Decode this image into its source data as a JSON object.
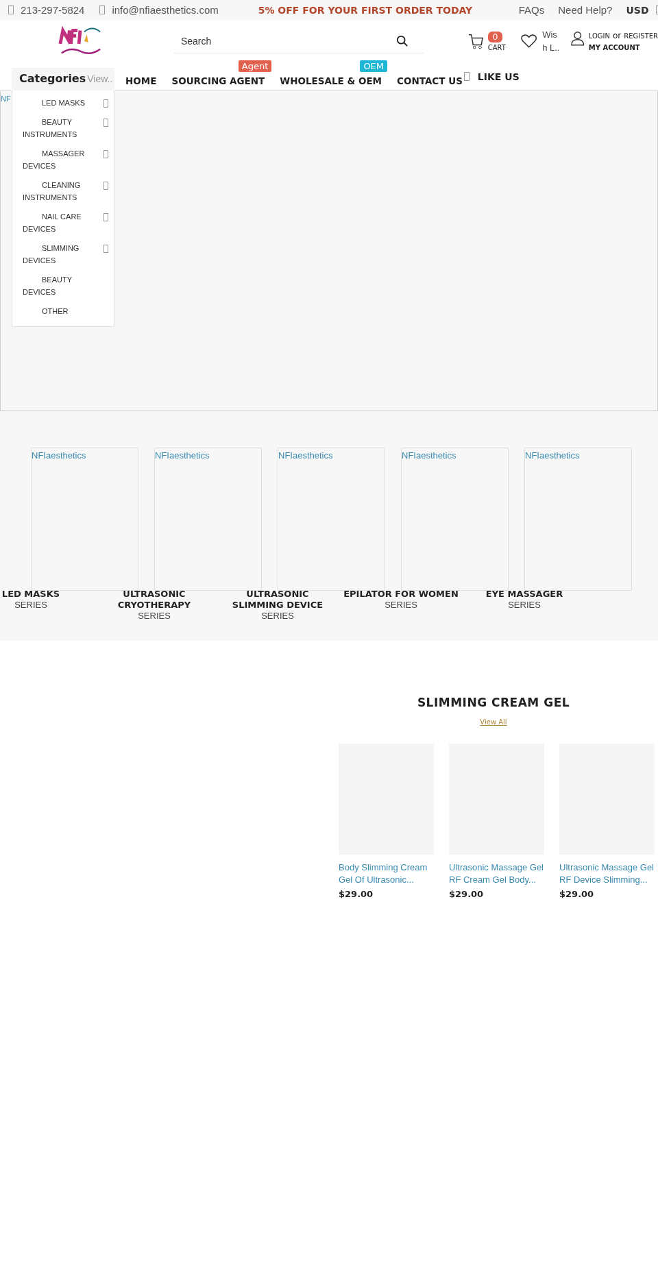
{
  "top_bar": {
    "phone": "213-297-5824",
    "email": "info@nfiaesthetics.com",
    "promo": "5% OFF FOR YOUR FIRST ORDER TODAY",
    "links": [
      "FAQs",
      "Need Help?"
    ],
    "currency": "USD"
  },
  "header": {
    "search": {
      "placeholder": "Search"
    },
    "cart": {
      "count": "0",
      "label": "CART"
    },
    "wishlist": {
      "label": "Wish L.."
    },
    "account": {
      "login": "LOGIN",
      "or": "or",
      "register": "REGISTER",
      "label": "MY ACCOUNT"
    }
  },
  "categories": {
    "title": "Categories",
    "view": "View..",
    "items": [
      {
        "label": "LED MASKS",
        "has_submenu": true
      },
      {
        "label": "BEAUTY INSTRUMENTS",
        "has_submenu": true
      },
      {
        "label": "MASSAGER DEVICES",
        "has_submenu": true
      },
      {
        "label": "CLEANING INSTRUMENTS",
        "has_submenu": true
      },
      {
        "label": "NAIL CARE DEVICES",
        "has_submenu": true
      },
      {
        "label": "SLIMMING DEVICES",
        "has_submenu": true
      },
      {
        "label": "BEAUTY DEVICES",
        "has_submenu": false
      },
      {
        "label": "OTHER",
        "has_submenu": false
      }
    ]
  },
  "nav": [
    {
      "label": "HOME"
    },
    {
      "label": "SOURCING AGENT",
      "badge": "Agent",
      "color": "#e2604e"
    },
    {
      "label": "WHOLESALE & OEM",
      "badge": "OEM",
      "color": "#1db6d6"
    },
    {
      "label": "CONTACT US"
    }
  ],
  "like_us": "LIKE US",
  "hero": {
    "image_alt": "NF"
  },
  "series": [
    {
      "image_alt": "NFIaesthetics",
      "title": "LED MASKS",
      "subtitle": "SERIES"
    },
    {
      "image_alt": "NFIaesthetics",
      "title": "ULTRASONIC CRYOTHERAPY",
      "subtitle": "SERIES"
    },
    {
      "image_alt": "NFIaesthetics",
      "title": "ULTRASONIC SLIMMING DEVICE",
      "subtitle": "SERIES"
    },
    {
      "image_alt": "NFIaesthetics",
      "title": "EPILATOR FOR WOMEN",
      "subtitle": "SERIES"
    },
    {
      "image_alt": "NFIaesthetics",
      "title": "EYE MASSAGER",
      "subtitle": "SERIES"
    }
  ],
  "product_section": {
    "title": "SLIMMING CREAM GEL",
    "view_all": "View All",
    "products": [
      {
        "name": "Body Slimming Cream Gel Of Ultrasonic...",
        "price": "$29.00"
      },
      {
        "name": "Ultrasonic Massage Gel RF Cream Gel Body...",
        "price": "$29.00"
      },
      {
        "name": "Ultrasonic Massage Gel RF Device Slimming...",
        "price": "$29.00"
      }
    ]
  }
}
